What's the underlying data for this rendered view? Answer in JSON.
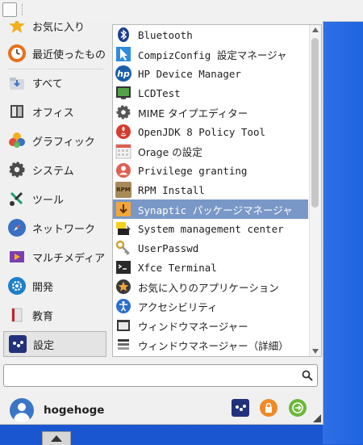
{
  "categories": [
    {
      "label": "お気に入り",
      "icon": "star-icon",
      "color": "#f2b01e"
    },
    {
      "label": "最近使ったもの",
      "icon": "clock-icon",
      "color": "#e86f1b"
    },
    {
      "label": "すべて",
      "icon": "download-folder-icon",
      "color": "#5c8bd6"
    },
    {
      "label": "オフィス",
      "icon": "office-icon",
      "color": "#444444"
    },
    {
      "label": "グラフィック",
      "icon": "graphics-icon",
      "color": "#e64a3c"
    },
    {
      "label": "システム",
      "icon": "gear-icon",
      "color": "#444444"
    },
    {
      "label": "ツール",
      "icon": "tools-icon",
      "color": "#1b9a76"
    },
    {
      "label": "ネットワーク",
      "icon": "compass-icon",
      "color": "#3b6fc4"
    },
    {
      "label": "マルチメディア",
      "icon": "multimedia-icon",
      "color": "#7b3fb0"
    },
    {
      "label": "開発",
      "icon": "development-icon",
      "color": "#1d7fc9"
    },
    {
      "label": "教育",
      "icon": "education-icon",
      "color": "#c4222c"
    },
    {
      "label": "設定",
      "icon": "settings-icon",
      "color": "#23307a"
    }
  ],
  "selected_category": "設定",
  "apps": [
    {
      "label": "Bluetooth",
      "icon": "bluetooth-icon"
    },
    {
      "label": "CompizConfig 設定マネージャ",
      "icon": "compiz-icon"
    },
    {
      "label": "HP Device Manager",
      "icon": "hp-icon"
    },
    {
      "label": "LCDTest",
      "icon": "lcd-monitor-icon"
    },
    {
      "label": "MIME タイプエディター",
      "icon": "gear-icon"
    },
    {
      "label": "OpenJDK 8 Policy Tool",
      "icon": "java-icon"
    },
    {
      "label": "Orage の設定",
      "icon": "calendar-icon"
    },
    {
      "label": "Privilege granting",
      "icon": "user-lock-icon"
    },
    {
      "label": "RPM Install",
      "icon": "rpm-package-icon"
    },
    {
      "label": "Synaptic パッケージマネージャ",
      "icon": "package-download-icon"
    },
    {
      "label": "System management center",
      "icon": "sysmgmt-icon"
    },
    {
      "label": "UserPasswd",
      "icon": "keys-icon"
    },
    {
      "label": "Xfce Terminal",
      "icon": "terminal-icon"
    },
    {
      "label": "お気に入りのアプリケーション",
      "icon": "star-circle-icon"
    },
    {
      "label": "アクセシビリティ",
      "icon": "accessibility-icon"
    },
    {
      "label": "ウィンドウマネージャー",
      "icon": "window-icon"
    },
    {
      "label": "ウィンドウマネージャー（詳細）",
      "icon": "window-advanced-icon"
    }
  ],
  "selected_app": "Synaptic パッケージマネージャ",
  "hp_icon_text": "hp",
  "rpm_icon_text": "RPM",
  "search": {
    "value": "",
    "placeholder": ""
  },
  "user": {
    "name": "hogehoge"
  },
  "colors": {
    "selection": "#7a98c7",
    "desktop": "#1e5bd6",
    "lock": "#f08a24",
    "logout": "#6bb83a"
  }
}
